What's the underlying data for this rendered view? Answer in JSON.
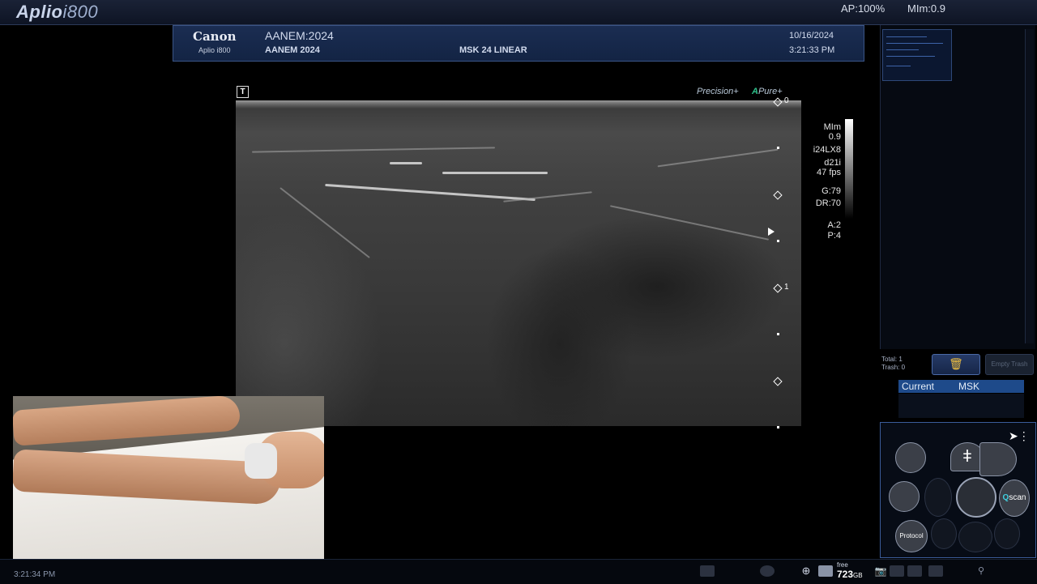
{
  "topbar": {
    "brand_name": "Aplio",
    "brand_model": "i800",
    "ap": "AP:100%",
    "mi": "MIm:0.9"
  },
  "header": {
    "logo": "Canon",
    "logo_sub": "Aplio i800",
    "institution": "AANEM:2024",
    "patient": "AANEM 2024",
    "preset": "MSK 24 LINEAR",
    "date": "10/16/2024",
    "time": "3:21:33 PM"
  },
  "image": {
    "t_marker": "T",
    "precision_label": "Precision+",
    "apure_label": "Pure+",
    "depth_labels": [
      "0",
      "1"
    ],
    "params": [
      "MIm",
      "0.9",
      "i24LX8",
      "d21i",
      "47 fps",
      "G:79",
      "DR:70",
      "A:2",
      "P:4"
    ]
  },
  "rightpanel": {
    "total": "Total: 1",
    "trash": "Trash: 0",
    "empty_trash": "Empty Trash",
    "current_label": "Current",
    "current_value": "MSK"
  },
  "pad": {
    "protocol": "Protocol",
    "qscan_q": "Q",
    "qscan_rest": "scan"
  },
  "bottombar": {
    "clock": "3:21:34 PM",
    "free_label": "free",
    "free_value": "723",
    "free_unit": "GB"
  }
}
